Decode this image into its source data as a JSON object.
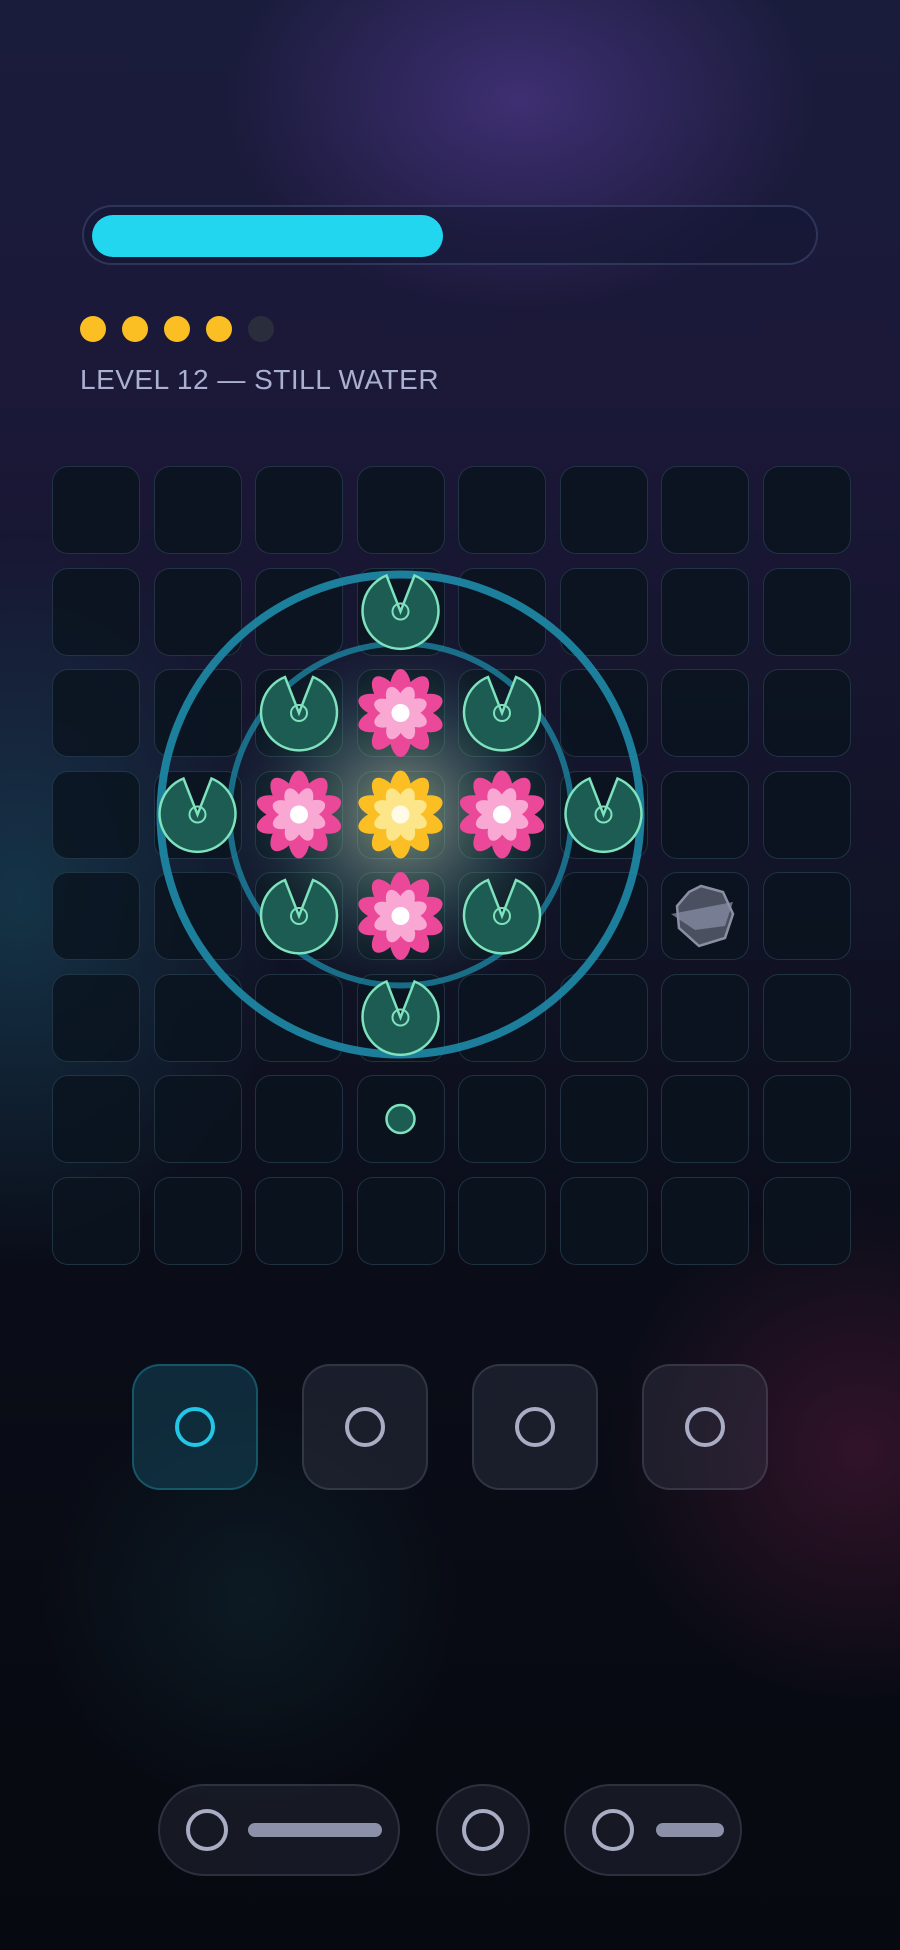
{
  "level": {
    "title": "LEVEL 12 — STILL WATER",
    "progress_fraction": 0.49,
    "stars_earned": 4,
    "stars_total": 5
  },
  "board": {
    "cols": 8,
    "rows": 8,
    "pieces": [
      {
        "type": "lily-pad",
        "col": 3,
        "row": 1
      },
      {
        "type": "lily-pad",
        "col": 2,
        "row": 2
      },
      {
        "type": "pink-lotus",
        "col": 3,
        "row": 2
      },
      {
        "type": "lily-pad",
        "col": 4,
        "row": 2
      },
      {
        "type": "lily-pad",
        "col": 1,
        "row": 3
      },
      {
        "type": "pink-lotus",
        "col": 2,
        "row": 3
      },
      {
        "type": "golden-lotus",
        "col": 3,
        "row": 3
      },
      {
        "type": "pink-lotus",
        "col": 4,
        "row": 3
      },
      {
        "type": "lily-pad",
        "col": 5,
        "row": 3
      },
      {
        "type": "lily-pad",
        "col": 2,
        "row": 4
      },
      {
        "type": "pink-lotus",
        "col": 3,
        "row": 4
      },
      {
        "type": "lily-pad",
        "col": 4,
        "row": 4
      },
      {
        "type": "rock",
        "col": 6,
        "row": 4
      },
      {
        "type": "lily-pad",
        "col": 3,
        "row": 5
      },
      {
        "type": "seed",
        "col": 3,
        "row": 6
      }
    ],
    "ripple_center": {
      "col": 3,
      "row": 3
    }
  },
  "tools": [
    {
      "icon": "ring-icon",
      "selected": true
    },
    {
      "icon": "ring-icon",
      "selected": false
    },
    {
      "icon": "ring-icon",
      "selected": false
    },
    {
      "icon": "ring-icon",
      "selected": false
    }
  ],
  "bottom_bar": [
    {
      "icon": "ring-icon",
      "has_bar": true
    },
    {
      "icon": "ring-icon",
      "has_bar": false
    },
    {
      "icon": "ring-icon",
      "has_bar": true
    }
  ],
  "colors": {
    "accent": "#22d6ef",
    "star": "#fbbf24",
    "lily_pad": "#1d5c52",
    "lily_pad_outline": "#7de2bd",
    "pink_lotus": "#ec4899",
    "golden_lotus": "#fbbf24",
    "ripple": "#1e8ba8"
  }
}
